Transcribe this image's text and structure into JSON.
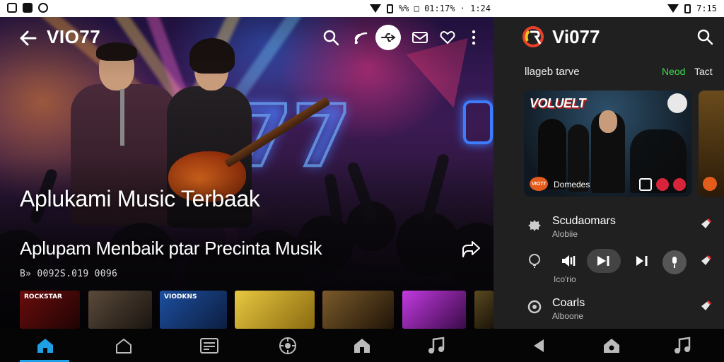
{
  "status_bar": {
    "left_time_text": "%%  □  01:17% · 1:24",
    "right_time_text": "7:15"
  },
  "main": {
    "app_title": "VIO77",
    "headline": "Aplukami Music Terbaak",
    "subline": "Aplupam Menbaik ptar Precinta Musik",
    "byline": "B» 0092S.019  0096",
    "thumbs": [
      {
        "label": "ROCKSTAR"
      },
      {
        "label": ""
      },
      {
        "label": "VIODKNS"
      },
      {
        "label": ""
      },
      {
        "label": ""
      },
      {
        "label": ""
      },
      {
        "label": ""
      }
    ]
  },
  "side": {
    "app_title": "Vi077",
    "section_title": "llageb tarve",
    "section_new": "Neod",
    "section_tact": "Tact",
    "card": {
      "title": "VOLUELT",
      "badge": "VIO77",
      "name": "Domedes"
    },
    "rows": [
      {
        "title": "Scudaomars",
        "sub": "Alobiie"
      },
      {
        "title": "Coarls",
        "sub": "Alboone"
      }
    ],
    "controls_label": "Ico'rio"
  },
  "icons": {
    "back": "arrow-left-icon",
    "search": "search-icon",
    "cast": "cast-icon",
    "usb": "usb-icon",
    "mail": "mail-icon",
    "heart": "heart-icon",
    "more": "more-vertical-icon",
    "share": "share-icon"
  },
  "colors": {
    "accent_blue": "#1ea0e6",
    "accent_green": "#3ddc4c",
    "side_bg": "#202020",
    "nav_bg": "#050505"
  }
}
